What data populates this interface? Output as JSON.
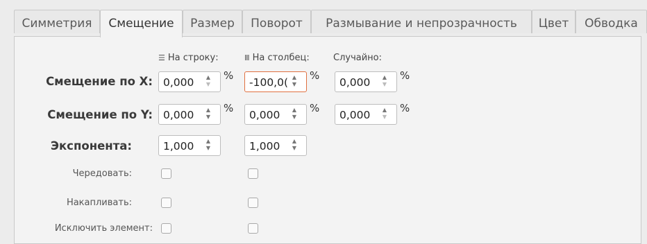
{
  "tabs": [
    {
      "label": "Симметрия"
    },
    {
      "label": "Смещение"
    },
    {
      "label": "Размер"
    },
    {
      "label": "Поворот"
    },
    {
      "label": "Размывание и непрозрачность"
    },
    {
      "label": "Цвет"
    },
    {
      "label": "Обводка"
    }
  ],
  "active_tab": "Смещение",
  "columns": {
    "per_row": {
      "label": "На строку:",
      "icon": "rows-icon"
    },
    "per_column": {
      "label": "На столбец:",
      "icon": "columns-icon"
    },
    "random": {
      "label": "Случайно:"
    }
  },
  "rows": {
    "shift_x": {
      "label": "Смещение по X:",
      "per_row": "0,000",
      "per_column": "-100,0(",
      "random": "0,000",
      "unit": "%"
    },
    "shift_y": {
      "label": "Смещение по Y:",
      "per_row": "0,000",
      "per_column": "0,000",
      "random": "0,000",
      "unit": "%"
    },
    "exponent": {
      "label": "Экспонента:",
      "per_row": "1,000",
      "per_column": "1,000"
    },
    "alternate": {
      "label": "Чередовать:",
      "per_row_checked": false,
      "per_column_checked": false
    },
    "cumulate": {
      "label": "Накапливать:",
      "per_row_checked": false,
      "per_column_checked": false
    },
    "exclude": {
      "label": "Исключить элемент:",
      "per_row_checked": false,
      "per_column_checked": false
    }
  },
  "colors": {
    "focus_border": "#e07040",
    "panel_bg": "#f3f3f3"
  }
}
